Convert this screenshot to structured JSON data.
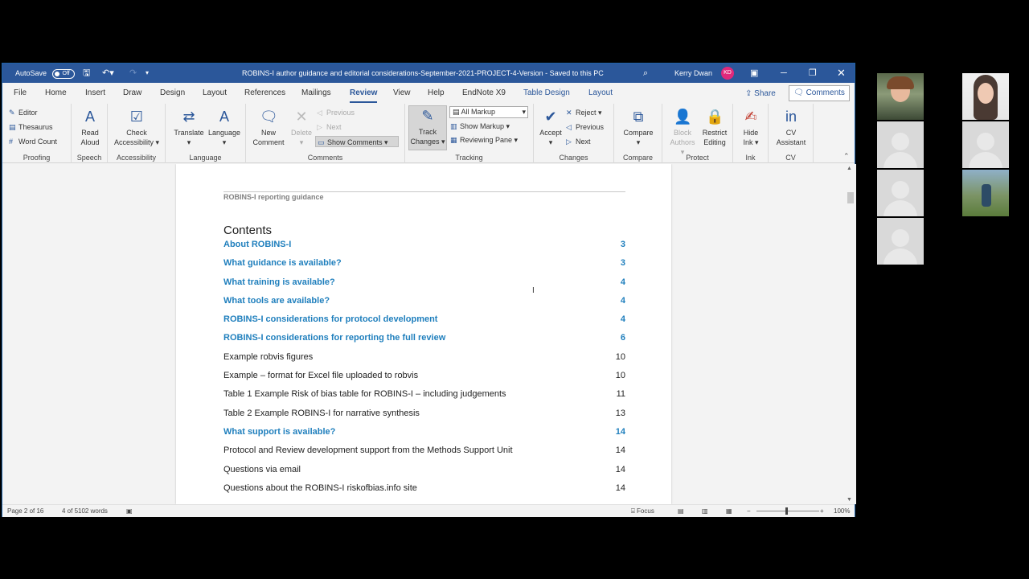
{
  "titlebar": {
    "autosave_label": "AutoSave",
    "autosave_state": "Off",
    "document_title": "ROBINS-I author guidance and editorial considerations-September-2021-PROJECT-4-Version  -  Saved to this PC",
    "user_name": "Kerry Dwan",
    "user_initials": "KD"
  },
  "menu": {
    "tabs": [
      "File",
      "Home",
      "Insert",
      "Draw",
      "Design",
      "Layout",
      "References",
      "Mailings",
      "Review",
      "View",
      "Help",
      "EndNote X9",
      "Table Design",
      "Layout"
    ],
    "active_tab": "Review",
    "share_label": "Share",
    "comments_label": "Comments"
  },
  "ribbon": {
    "proofing": {
      "label": "Proofing",
      "editor": "Editor",
      "thesaurus": "Thesaurus",
      "word_count": "Word Count"
    },
    "speech": {
      "label": "Speech",
      "read_aloud_1": "Read",
      "read_aloud_2": "Aloud"
    },
    "accessibility": {
      "label": "Accessibility",
      "check_1": "Check",
      "check_2": "Accessibility"
    },
    "language": {
      "label": "Language",
      "translate": "Translate",
      "language": "Language"
    },
    "comments": {
      "label": "Comments",
      "new_1": "New",
      "new_2": "Comment",
      "delete": "Delete",
      "previous": "Previous",
      "next": "Next",
      "show_comments": "Show Comments"
    },
    "tracking": {
      "label": "Tracking",
      "track_1": "Track",
      "track_2": "Changes",
      "markup_select": "All Markup",
      "show_markup": "Show Markup",
      "reviewing_pane": "Reviewing Pane"
    },
    "changes": {
      "label": "Changes",
      "accept": "Accept",
      "reject": "Reject",
      "previous": "Previous",
      "next": "Next"
    },
    "compare": {
      "label": "Compare",
      "compare": "Compare"
    },
    "protect": {
      "label": "Protect",
      "block_1": "Block",
      "block_2": "Authors",
      "restrict_1": "Restrict",
      "restrict_2": "Editing"
    },
    "ink": {
      "label": "Ink",
      "hide_1": "Hide",
      "hide_2": "Ink"
    },
    "cv": {
      "label": "CV",
      "cv_1": "CV",
      "cv_2": "Assistant"
    }
  },
  "document": {
    "header": "ROBINS-I reporting guidance",
    "contents_title": "Contents",
    "toc": [
      {
        "title": "About ROBINS-I",
        "page": "3",
        "level": "h1"
      },
      {
        "title": "What guidance is available?",
        "page": "3",
        "level": "h1"
      },
      {
        "title": "What training is available?",
        "page": "4",
        "level": "h1"
      },
      {
        "title": "What tools are available?",
        "page": "4",
        "level": "h1"
      },
      {
        "title": "ROBINS-I considerations for protocol development",
        "page": "4",
        "level": "h1"
      },
      {
        "title": "ROBINS-I considerations for reporting the full review",
        "page": "6",
        "level": "h1"
      },
      {
        "title": "Example robvis figures",
        "page": "10",
        "level": "h2"
      },
      {
        "title": "Example – format for Excel file uploaded to robvis",
        "page": "10",
        "level": "h2"
      },
      {
        "title": "Table 1 Example Risk of bias table for ROBINS-I – including judgements",
        "page": "11",
        "level": "h2"
      },
      {
        "title": "Table 2 Example ROBINS-I for narrative synthesis",
        "page": "13",
        "level": "h2"
      },
      {
        "title": "What support is available?",
        "page": "14",
        "level": "h1"
      },
      {
        "title": "Protocol and Review development support from the Methods Support Unit",
        "page": "14",
        "level": "h2"
      },
      {
        "title": "Questions via email",
        "page": "14",
        "level": "h2"
      },
      {
        "title": "Questions about the ROBINS-I riskofbias.info site",
        "page": "14",
        "level": "h2"
      }
    ]
  },
  "status": {
    "page": "Page 2 of 16",
    "words": "4 of 5102 words",
    "focus": "Focus",
    "zoom": "100%"
  },
  "colors": {
    "brand": "#2b579a",
    "toc_heading": "#1f7fbd"
  }
}
